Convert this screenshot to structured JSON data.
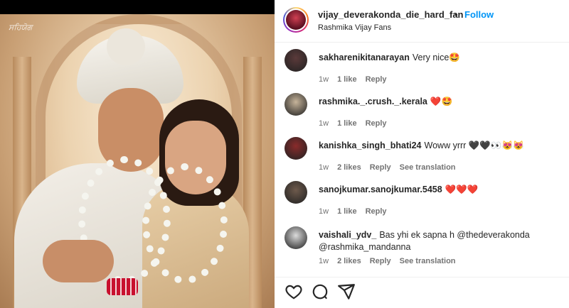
{
  "post": {
    "watermark": "ਸਹਿਯੋਗ"
  },
  "header": {
    "username": "vijay_deverakonda_die_hard_fan",
    "dot": "•",
    "follow_label": "Follow",
    "subtitle": "Rashmika Vijay Fans",
    "avatar_icon": "profile-avatar"
  },
  "comments": [
    {
      "user": "sakharenikitanarayan",
      "text": "Very nice🤩",
      "time": "1w",
      "likes": "1 like",
      "reply": "Reply",
      "translation": "",
      "avatar_color": "#5b3a3a"
    },
    {
      "user": "rashmika._.crush._.kerala",
      "text": "❤️🤩",
      "time": "1w",
      "likes": "1 like",
      "reply": "Reply",
      "translation": "",
      "avatar_color": "#c7b49a"
    },
    {
      "user": "kanishka_singh_bhati24",
      "text": "Woww yrrr 🖤🖤👀😻😻",
      "time": "1w",
      "likes": "2 likes",
      "reply": "Reply",
      "translation": "See translation",
      "avatar_color": "#8a2b2b"
    },
    {
      "user": "sanojkumar.sanojkumar.5458",
      "text": "❤️❤️❤️",
      "time": "1w",
      "likes": "1 like",
      "reply": "Reply",
      "translation": "",
      "avatar_color": "#6e5a4c"
    },
    {
      "user": "vaishali_ydv_",
      "text": "Bas yhi ek sapna h @thedeverakonda @rashmika_mandanna",
      "time": "1w",
      "likes": "2 likes",
      "reply": "Reply",
      "translation": "See translation",
      "avatar_color": "#dbdbdb"
    }
  ],
  "actions": {
    "like_icon": "heart-icon",
    "comment_icon": "comment-icon",
    "share_icon": "share-icon"
  },
  "colors": {
    "accent": "#0095f6",
    "text": "#262626",
    "muted": "#737373"
  }
}
